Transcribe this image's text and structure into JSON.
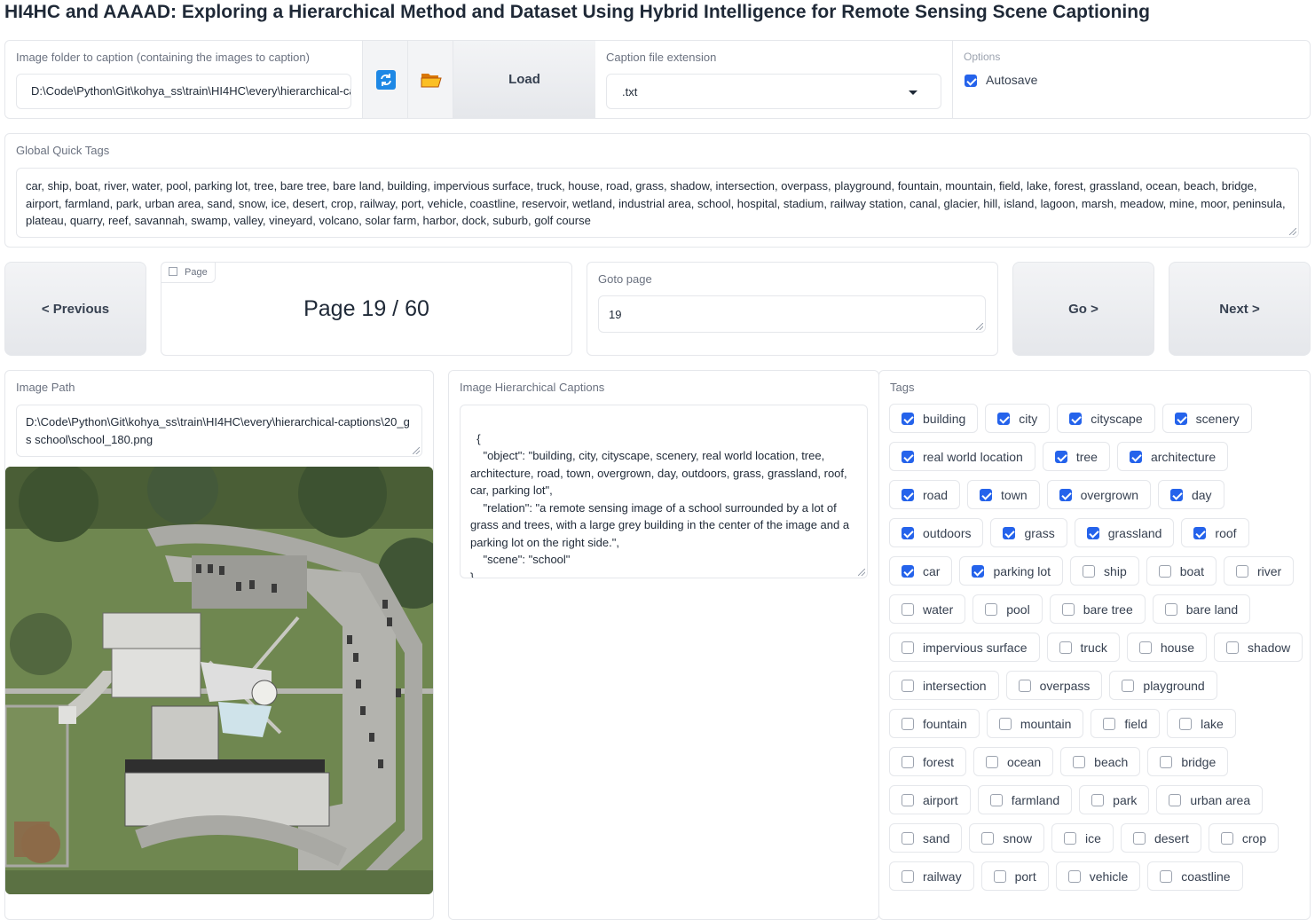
{
  "title": "HI4HC and AAAAD: Exploring a Hierarchical Method and Dataset Using Hybrid Intelligence for Remote Sensing Scene Captioning",
  "folder": {
    "label": "Image folder to caption (containing the images to caption)",
    "value": "D:\\Code\\Python\\Git\\kohya_ss\\train\\HI4HC\\every\\hierarchical-captions",
    "refresh_icon": "refresh-icon",
    "folder_icon": "folder-icon",
    "load_label": "Load"
  },
  "extension": {
    "label": "Caption file extension",
    "value": ".txt"
  },
  "options": {
    "label": "Options",
    "autosave_label": "Autosave",
    "autosave_checked": true
  },
  "quick_tags": {
    "label": "Global Quick Tags",
    "value": "car, ship, boat, river, water, pool, parking lot, tree, bare tree, bare land, building, impervious surface, truck, house, road, grass, shadow, intersection, overpass, playground, fountain, mountain, field, lake, forest, grassland, ocean, beach, bridge, airport, farmland, park, urban area, sand, snow, ice, desert, crop, railway, port, vehicle, coastline, reservoir, wetland, industrial area, school, hospital, stadium, railway station, canal, glacier, hill, island, lagoon, marsh, meadow, mine, moor, peninsula, plateau, quarry, reef, savannah, swamp, valley, vineyard, volcano, solar farm, harbor, dock, suburb, golf course"
  },
  "pager": {
    "previous_label": "< Previous",
    "page_tag": "Page",
    "page_text": "Page 19 / 60",
    "goto_label": "Goto page",
    "goto_value": "19",
    "go_label": "Go >",
    "next_label": "Next >"
  },
  "image_path": {
    "label": "Image Path",
    "value": "D:\\Code\\Python\\Git\\kohya_ss\\train\\HI4HC\\every\\hierarchical-captions\\20_gs school\\school_180.png"
  },
  "captions": {
    "label": "Image Hierarchical Captions",
    "value": "{\n    \"object\": \"building, city, cityscape, scenery, real world location, tree, architecture, road, town, overgrown, day, outdoors, grass, grassland, roof, car, parking lot\",\n    \"relation\": \"a remote sensing image of a school surrounded by a lot of grass and trees, with a large grey building in the center of the image and a parking lot on the right side.\",\n    \"scene\": \"school\"\n}"
  },
  "tags_label": "Tags",
  "tags": [
    {
      "label": "building",
      "checked": true
    },
    {
      "label": "city",
      "checked": true
    },
    {
      "label": "cityscape",
      "checked": true
    },
    {
      "label": "scenery",
      "checked": true
    },
    {
      "label": "real world location",
      "checked": true
    },
    {
      "label": "tree",
      "checked": true
    },
    {
      "label": "architecture",
      "checked": true
    },
    {
      "label": "road",
      "checked": true
    },
    {
      "label": "town",
      "checked": true
    },
    {
      "label": "overgrown",
      "checked": true
    },
    {
      "label": "day",
      "checked": true
    },
    {
      "label": "outdoors",
      "checked": true
    },
    {
      "label": "grass",
      "checked": true
    },
    {
      "label": "grassland",
      "checked": true
    },
    {
      "label": "roof",
      "checked": true
    },
    {
      "label": "car",
      "checked": true
    },
    {
      "label": "parking lot",
      "checked": true
    },
    {
      "label": "ship",
      "checked": false
    },
    {
      "label": "boat",
      "checked": false
    },
    {
      "label": "river",
      "checked": false
    },
    {
      "label": "water",
      "checked": false
    },
    {
      "label": "pool",
      "checked": false
    },
    {
      "label": "bare tree",
      "checked": false
    },
    {
      "label": "bare land",
      "checked": false
    },
    {
      "label": "impervious surface",
      "checked": false
    },
    {
      "label": "truck",
      "checked": false
    },
    {
      "label": "house",
      "checked": false
    },
    {
      "label": "shadow",
      "checked": false
    },
    {
      "label": "intersection",
      "checked": false
    },
    {
      "label": "overpass",
      "checked": false
    },
    {
      "label": "playground",
      "checked": false
    },
    {
      "label": "fountain",
      "checked": false
    },
    {
      "label": "mountain",
      "checked": false
    },
    {
      "label": "field",
      "checked": false
    },
    {
      "label": "lake",
      "checked": false
    },
    {
      "label": "forest",
      "checked": false
    },
    {
      "label": "ocean",
      "checked": false
    },
    {
      "label": "beach",
      "checked": false
    },
    {
      "label": "bridge",
      "checked": false
    },
    {
      "label": "airport",
      "checked": false
    },
    {
      "label": "farmland",
      "checked": false
    },
    {
      "label": "park",
      "checked": false
    },
    {
      "label": "urban area",
      "checked": false
    },
    {
      "label": "sand",
      "checked": false
    },
    {
      "label": "snow",
      "checked": false
    },
    {
      "label": "ice",
      "checked": false
    },
    {
      "label": "desert",
      "checked": false
    },
    {
      "label": "crop",
      "checked": false
    },
    {
      "label": "railway",
      "checked": false
    },
    {
      "label": "port",
      "checked": false
    },
    {
      "label": "vehicle",
      "checked": false
    },
    {
      "label": "coastline",
      "checked": false
    }
  ],
  "colors": {
    "accent": "#2563eb",
    "border": "#e5e7eb",
    "label": "#6b7280"
  }
}
